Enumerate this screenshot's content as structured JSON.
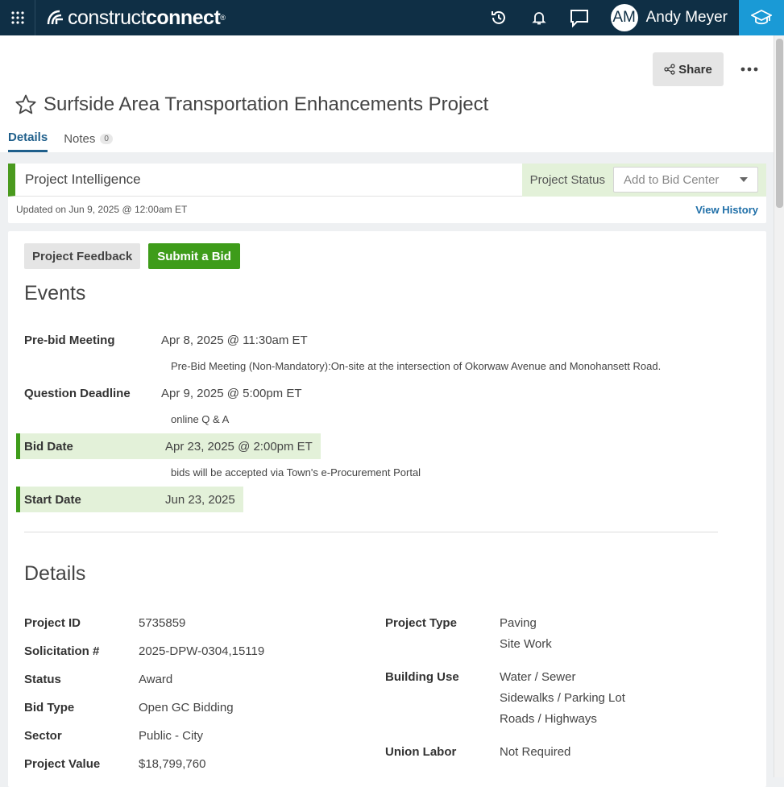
{
  "app": {
    "logo_light": "construct",
    "logo_bold": "connect",
    "user_initials": "AM",
    "user_name": "Andy Meyer",
    "colors": {
      "navy": "#0f2f45",
      "accent_blue": "#1a9ad6",
      "green": "#3e9c1a",
      "light_green": "#e3f1d9"
    }
  },
  "toolbar": {
    "share_label": "Share"
  },
  "project": {
    "title": "Surfside Area Transportation Enhancements Project"
  },
  "tabs": [
    {
      "label": "Details"
    },
    {
      "label": "Notes",
      "count": "0"
    }
  ],
  "intel": {
    "title": "Project Intelligence",
    "status_label": "Project Status",
    "status_value": "Add to Bid Center",
    "updated": "Updated on Jun 9, 2025 @ 12:00am ET",
    "view_history": "View History"
  },
  "actions": {
    "feedback": "Project Feedback",
    "submit": "Submit a Bid"
  },
  "events": {
    "heading": "Events",
    "items": [
      {
        "label": "Pre-bid Meeting",
        "value": "Apr 8, 2025 @ 11:30am ET",
        "note": "Pre-Bid Meeting (Non-Mandatory):On-site at the intersection of Okorwaw Avenue and Monohansett Road."
      },
      {
        "label": "Question Deadline",
        "value": "Apr 9, 2025 @ 5:00pm ET",
        "note": "online Q & A"
      },
      {
        "label": "Bid Date",
        "value": "Apr 23, 2025 @ 2:00pm ET",
        "note": "bids will be accepted via Town's e-Procurement Portal"
      },
      {
        "label": "Start Date",
        "value": "Jun 23, 2025",
        "note": ""
      }
    ]
  },
  "details": {
    "heading": "Details",
    "left": [
      {
        "label": "Project ID",
        "value": "5735859"
      },
      {
        "label": "Solicitation #",
        "value": "2025-DPW-0304,15119"
      },
      {
        "label": "Status",
        "value": "Award"
      },
      {
        "label": "Bid Type",
        "value": "Open GC Bidding"
      },
      {
        "label": "Sector",
        "value": "Public - City"
      },
      {
        "label": "Project Value",
        "value": "$18,799,760"
      }
    ],
    "right": [
      {
        "label": "Project Type",
        "values": [
          "Paving",
          "Site Work"
        ]
      },
      {
        "label": "Building Use",
        "values": [
          "Water / Sewer",
          "Sidewalks / Parking Lot",
          "Roads / Highways"
        ]
      },
      {
        "label": "Union Labor",
        "values": [
          "Not Required"
        ]
      }
    ]
  }
}
